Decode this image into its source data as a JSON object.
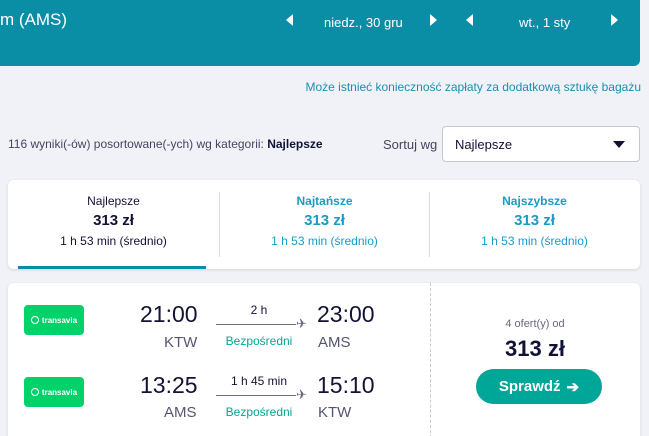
{
  "header": {
    "route": "m (AMS)",
    "outbound_date": "niedz., 30 gru",
    "return_date": "wt., 1 sty"
  },
  "baggage_notice": "Może istnieć konieczność zapłaty za dodatkową sztukę bagażu",
  "results": {
    "count_text": "116 wyniki(-ów) posortowane(-ych) wg kategorii:",
    "sort_category": "Najlepsze"
  },
  "sort": {
    "label": "Sortuj wg",
    "selected": "Najlepsze"
  },
  "tabs": [
    {
      "name": "Najlepsze",
      "price": "313 zł",
      "duration": "1 h 53 min (średnio)",
      "active": true
    },
    {
      "name": "Najtańsze",
      "price": "313 zł",
      "duration": "1 h 53 min (średnio)",
      "active": false
    },
    {
      "name": "Najszybsze",
      "price": "313 zł",
      "duration": "1 h 53 min (średnio)",
      "active": false
    }
  ],
  "flight_card": {
    "legs": [
      {
        "airline": "transavia",
        "depart_time": "21:00",
        "depart_airport": "KTW",
        "duration": "2 h",
        "stops": "Bezpośredni",
        "arrive_time": "23:00",
        "arrive_airport": "AMS"
      },
      {
        "airline": "transavia",
        "depart_time": "13:25",
        "depart_airport": "AMS",
        "duration": "1 h 45 min",
        "stops": "Bezpośredni",
        "arrive_time": "15:10",
        "arrive_airport": "KTW"
      }
    ],
    "offers": "4 ofert(y) od",
    "price": "313 zł",
    "select_label": "Sprawdź"
  },
  "colors": {
    "header_bg": "#0a8ea5",
    "accent_link": "#1a8eb3",
    "direct_green": "#00a698",
    "airline_green": "#00d26a"
  },
  "icons": [
    "chevron-left-icon",
    "chevron-right-icon",
    "caret-down-icon",
    "plane-icon",
    "arrow-right-icon"
  ]
}
